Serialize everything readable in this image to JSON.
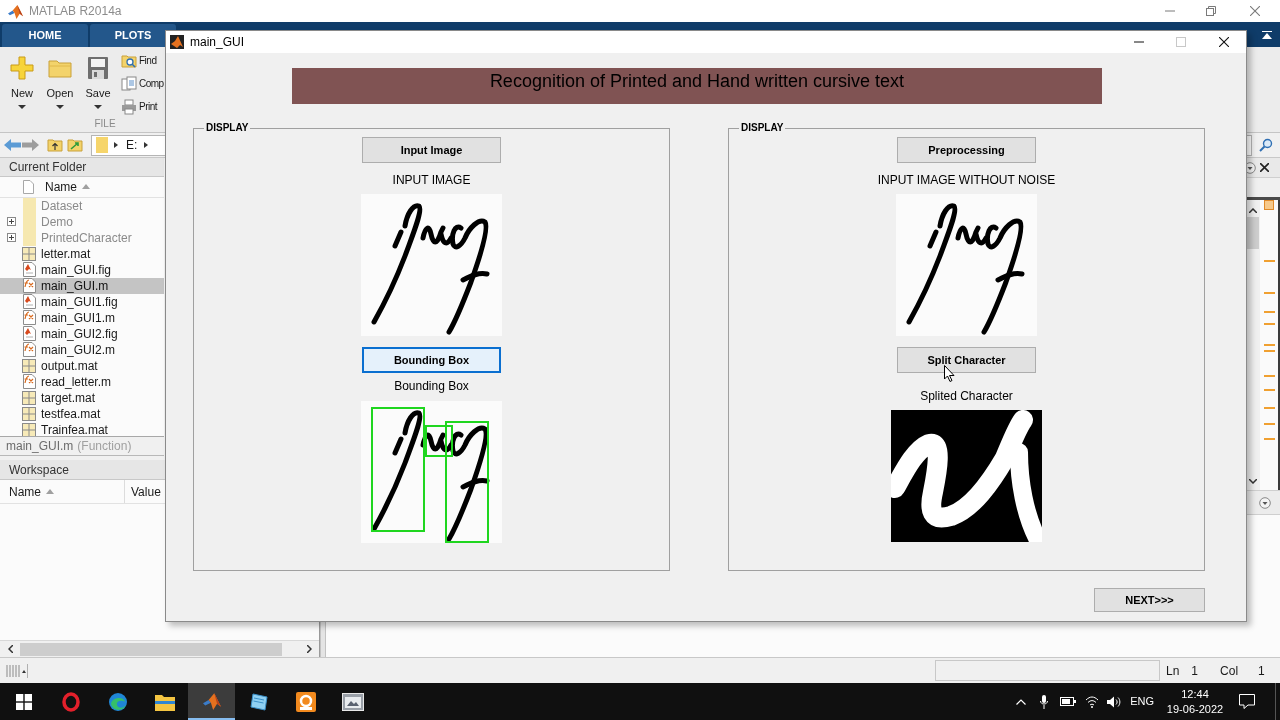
{
  "matlab": {
    "title": "MATLAB R2014a",
    "tabs": [
      {
        "label": "HOME",
        "selected": false
      },
      {
        "label": "PLOTS",
        "selected": false
      }
    ],
    "toolstrip": {
      "large_buttons": [
        "New",
        "Open",
        "Save"
      ],
      "small_buttons": [
        "Find",
        "Comp",
        "Print"
      ],
      "section": "FILE"
    },
    "address": {
      "path": [
        "E:"
      ]
    },
    "current_folder": {
      "title": "Current Folder",
      "column": "Name",
      "items": [
        {
          "name": "Dataset",
          "kind": "folder",
          "expandable": false,
          "selected": false
        },
        {
          "name": "Demo",
          "kind": "folder",
          "expandable": true,
          "selected": false
        },
        {
          "name": "PrintedCharacter",
          "kind": "folder",
          "expandable": true,
          "selected": false
        },
        {
          "name": "letter.mat",
          "kind": "mat",
          "expandable": false,
          "selected": false
        },
        {
          "name": "main_GUI.fig",
          "kind": "fig",
          "expandable": false,
          "selected": false
        },
        {
          "name": "main_GUI.m",
          "kind": "m",
          "expandable": false,
          "selected": true
        },
        {
          "name": "main_GUI1.fig",
          "kind": "fig",
          "expandable": false,
          "selected": false
        },
        {
          "name": "main_GUI1.m",
          "kind": "m",
          "expandable": false,
          "selected": false
        },
        {
          "name": "main_GUI2.fig",
          "kind": "fig",
          "expandable": false,
          "selected": false
        },
        {
          "name": "main_GUI2.m",
          "kind": "m",
          "expandable": false,
          "selected": false
        },
        {
          "name": "output.mat",
          "kind": "mat",
          "expandable": false,
          "selected": false
        },
        {
          "name": "read_letter.m",
          "kind": "m",
          "expandable": false,
          "selected": false
        },
        {
          "name": "target.mat",
          "kind": "mat",
          "expandable": false,
          "selected": false
        },
        {
          "name": "testfea.mat",
          "kind": "mat",
          "expandable": false,
          "selected": false
        },
        {
          "name": "Trainfea.mat",
          "kind": "mat",
          "expandable": false,
          "selected": false
        }
      ],
      "details": {
        "name": "main_GUI.m",
        "type": "(Function)"
      }
    },
    "workspace": {
      "title": "Workspace",
      "columns": [
        "Name",
        "Value"
      ]
    },
    "status_bar": {
      "fields": [
        {
          "label": "Ln",
          "value": "1"
        },
        {
          "label": "Col",
          "value": "1"
        }
      ]
    }
  },
  "figure": {
    "title": "main_GUI",
    "maximize_enabled": false,
    "banner": "Recognition of Printed and Hand written cursive text",
    "panels": [
      {
        "title": "DISPLAY",
        "sections": [
          {
            "button": {
              "label": "Input Image",
              "focused": false
            },
            "caption": "INPUT IMAGE",
            "image": {
              "kind": "handwriting"
            }
          },
          {
            "button": {
              "label": "Bounding Box",
              "focused": true
            },
            "caption": "Bounding Box",
            "image": {
              "kind": "bounding_boxes"
            }
          }
        ]
      },
      {
        "title": "DISPLAY",
        "sections": [
          {
            "button": {
              "label": "Preprocessing",
              "focused": false
            },
            "caption": "INPUT IMAGE WITHOUT NOISE",
            "image": {
              "kind": "handwriting"
            }
          },
          {
            "button": {
              "label": "Split Character",
              "focused": false
            },
            "caption": "Splited Character",
            "image": {
              "kind": "character"
            }
          }
        ]
      }
    ],
    "next_button": {
      "label": "NEXT>>>",
      "focused": false
    }
  },
  "taskbar": {
    "apps": [
      {
        "selected": false
      },
      {
        "selected": false
      },
      {
        "selected": false
      },
      {
        "selected": true
      },
      {
        "selected": false
      },
      {
        "selected": false
      },
      {
        "selected": false
      }
    ],
    "tray": {
      "language": "ENG",
      "time": "12:44",
      "date": "19-06-2022"
    }
  }
}
